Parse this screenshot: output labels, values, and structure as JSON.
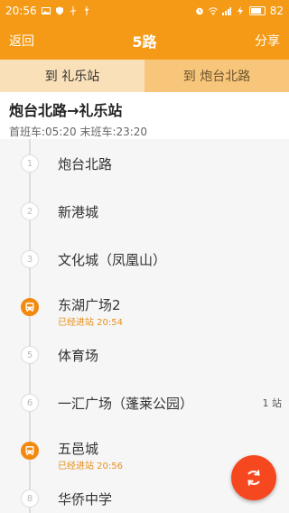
{
  "status": {
    "time": "20:56",
    "battery": "82",
    "battery_level": 0.82
  },
  "appbar": {
    "back_label": "返回",
    "title": "5路",
    "share_label": "分享"
  },
  "tabs": [
    {
      "label": "到 礼乐站",
      "active": true
    },
    {
      "label": "到 炮台北路",
      "active": false
    }
  ],
  "route": {
    "title": "炮台北路→礼乐站",
    "times": "首班车:05:20 末班车:23:20"
  },
  "stops": [
    {
      "index": "1",
      "name": "炮台北路",
      "bus": false,
      "sub": "",
      "extra": ""
    },
    {
      "index": "2",
      "name": "新港城",
      "bus": false,
      "sub": "",
      "extra": ""
    },
    {
      "index": "3",
      "name": "文化城（凤凰山）",
      "bus": false,
      "sub": "",
      "extra": ""
    },
    {
      "index": "4",
      "name": "东湖广场2",
      "bus": true,
      "sub": "已经进站 20:54",
      "extra": ""
    },
    {
      "index": "5",
      "name": "体育场",
      "bus": false,
      "sub": "",
      "extra": ""
    },
    {
      "index": "6",
      "name": "一汇广场（蓬莱公园）",
      "bus": false,
      "sub": "",
      "extra": "1 站"
    },
    {
      "index": "7",
      "name": "五邑城",
      "bus": true,
      "sub": "已经进站 20:56",
      "extra": ""
    },
    {
      "index": "8",
      "name": "华侨中学",
      "bus": false,
      "sub": "",
      "extra": ""
    }
  ],
  "colors": {
    "accent": "#f59a16",
    "bus_marker": "#f28a10",
    "fab": "#f5481e"
  }
}
